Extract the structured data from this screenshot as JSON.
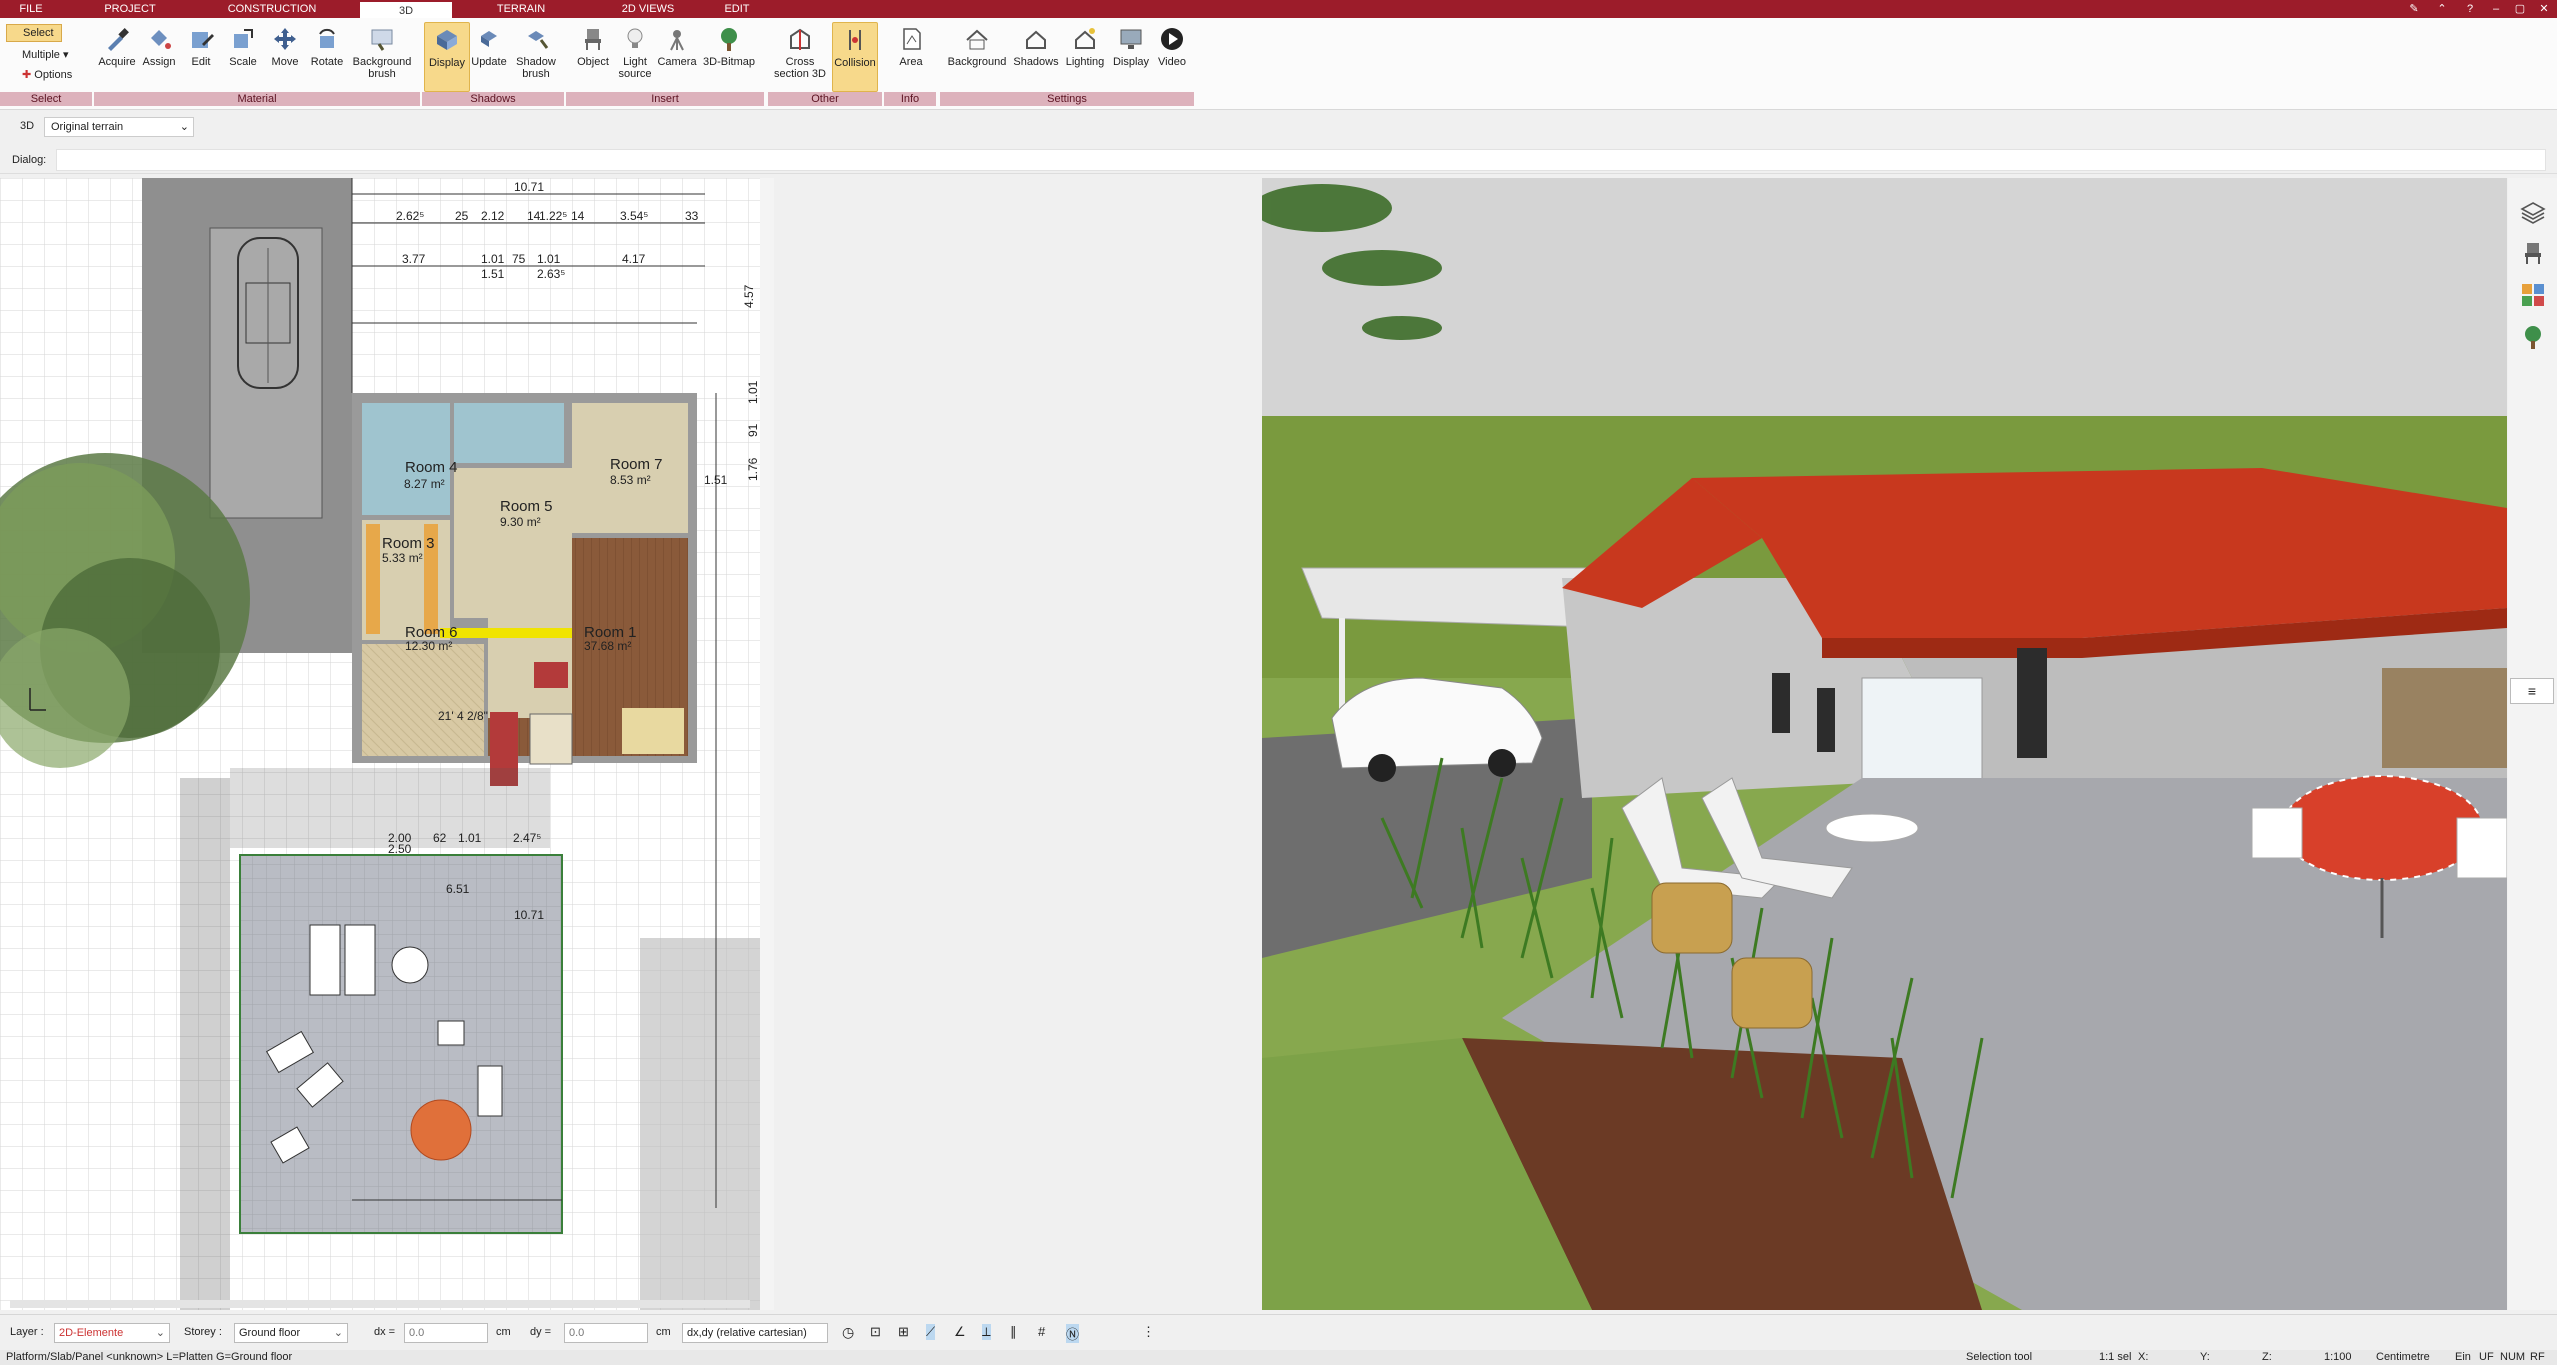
{
  "menu": {
    "tabs": [
      "FILE",
      "PROJECT",
      "CONSTRUCTION",
      "3D",
      "TERRAIN",
      "2D VIEWS",
      "EDIT"
    ],
    "active": "3D"
  },
  "ribbon": {
    "select": {
      "select_label": "Select",
      "multiple_label": "Multiple",
      "options_label": "Options",
      "group": "Select"
    },
    "material": {
      "buttons": [
        "Acquire",
        "Assign",
        "Edit",
        "Scale",
        "Move",
        "Rotate",
        "Background brush"
      ],
      "group": "Material"
    },
    "shadows": {
      "buttons": [
        "Display",
        "Update",
        "Shadow brush"
      ],
      "group": "Shadows"
    },
    "insert": {
      "buttons": [
        "Object",
        "Light source",
        "Camera",
        "3D-Bitmap"
      ],
      "group": "Insert"
    },
    "other": {
      "buttons": [
        "Cross section 3D",
        "Collision"
      ],
      "group": "Other"
    },
    "info": {
      "buttons": [
        "Area"
      ],
      "group": "Info"
    },
    "settings": {
      "buttons": [
        "Background",
        "Shadows",
        "Lighting",
        "Display",
        "Video"
      ],
      "group": "Settings"
    }
  },
  "viewbar": {
    "mode": "3D",
    "terrain": "Original terrain"
  },
  "dialog": {
    "label": "Dialog:",
    "value": ""
  },
  "plan": {
    "dims_top": [
      "10.71",
      "2.62⁵",
      "25",
      "2.12",
      "14",
      "1.22⁵",
      "14",
      "3.54⁵",
      "33",
      "3.77",
      "1.01",
      "1.51",
      "75",
      "1.01",
      "2.63⁵",
      "4.17"
    ],
    "dims_bottom": [
      "2.00",
      "2.50",
      "62",
      "1.01",
      "2.47⁵",
      "10.71"
    ],
    "rooms": [
      {
        "name": "Room 4",
        "area": "8.27 m²"
      },
      {
        "name": "Room 7",
        "area": "8.53 m²"
      },
      {
        "name": "Room 5",
        "area": "9.30 m²"
      },
      {
        "name": "Room 3",
        "area": "5.33 m²"
      },
      {
        "name": "Room 6",
        "area": "12.30 m²"
      },
      {
        "name": "Room 1",
        "area": "37.68 m²"
      }
    ],
    "terrace_area": "21' 4 2/8\"",
    "side_dims": [
      "4.57",
      "1.01",
      "91",
      "1.76",
      "1.51",
      "6.51"
    ]
  },
  "status": {
    "layer_label": "Layer :",
    "layer_value": "2D-Elemente",
    "storey_label": "Storey :",
    "storey_value": "Ground floor",
    "dx_label": "dx =",
    "dx_value": "0.0",
    "dx_unit": "cm",
    "dy_label": "dy =",
    "dy_value": "0.0",
    "dy_unit": "cm",
    "coord_mode": "dx,dy (relative cartesian)",
    "info_line": "Platform/Slab/Panel <unknown> L=Platten G=Ground floor",
    "tool": "Selection tool",
    "scale": "1:1 sel",
    "x_label": "X:",
    "y_label": "Y:",
    "z_label": "Z:",
    "ratio": "1:100",
    "unit": "Centimetre",
    "ein": "Ein",
    "uf": "UF",
    "num": "NUM",
    "rf": "RF"
  },
  "colors": {
    "brand": "#9c1c2a",
    "active_tool": "#f7d98b",
    "group_band": "#ddb2bc",
    "roof": "#c8381e"
  }
}
